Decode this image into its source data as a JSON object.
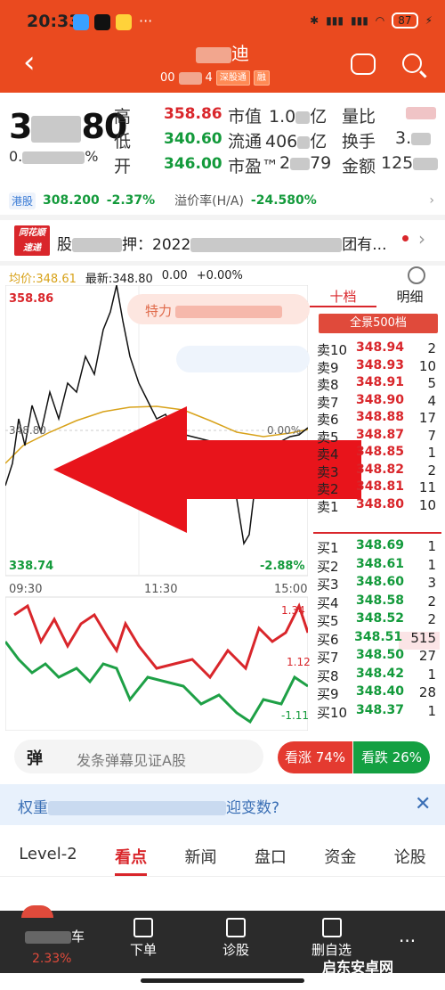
{
  "status": {
    "time": "20:33",
    "battery": "87",
    "dots": "···"
  },
  "header": {
    "back": "‹",
    "title_suffix": "迪",
    "code_prefix": "00",
    "code_suffix": "4",
    "tag1": "深股通",
    "tag2": "融"
  },
  "quote": {
    "price_a": "3",
    "price_b": "80",
    "change_prefix": "0.",
    "change_suffix": "%",
    "high_label": "高",
    "high": "358.86",
    "low_label": "低",
    "low": "340.60",
    "open_label": "开",
    "open": "346.00",
    "mktcap_label": "市值",
    "mktcap_a": "1.0",
    "mktcap_b": "亿",
    "float_label": "流通",
    "float_a": "406",
    "float_b": "亿",
    "pe_label": "市盈™",
    "pe_a": "2",
    "pe_b": "79",
    "vr_label": "量比",
    "turnover_label": "换手",
    "turnover_a": "3.",
    "amount_label": "金额",
    "amount_a": "125"
  },
  "hk": {
    "tag": "港股",
    "price": "308.200",
    "change": "-2.37%",
    "premium_label": "溢价率(H/A)",
    "premium": "-24.580%"
  },
  "news": {
    "logo_top": "同花顺",
    "logo_bottom": "速递",
    "text_a": "股",
    "text_b": "押：2022",
    "text_c": "团有..."
  },
  "chart_head": {
    "avg": "均价:348.61",
    "latest": "最新:348.80",
    "chg": "0.00",
    "pct": "+0.00%"
  },
  "chart": {
    "high": "358.86",
    "mid": "348.80",
    "low": "338.74",
    "pct_mid": "0.00%",
    "pct_low": "-2.88%",
    "times": [
      "09:30",
      "11:30",
      "15:00"
    ],
    "vol_hi": "1.34",
    "vol_mid": "1.12",
    "vol_lo": "-1.11",
    "pill_text": "特力"
  },
  "orderbook": {
    "tab1": "十档",
    "tab2": "明细",
    "full": "全景500档",
    "asks": [
      {
        "l": "卖10",
        "p": "348.94",
        "v": "2"
      },
      {
        "l": "卖9",
        "p": "348.93",
        "v": "10"
      },
      {
        "l": "卖8",
        "p": "348.91",
        "v": "5"
      },
      {
        "l": "卖7",
        "p": "348.90",
        "v": "4"
      },
      {
        "l": "卖6",
        "p": "348.88",
        "v": "17"
      },
      {
        "l": "卖5",
        "p": "348.87",
        "v": "7"
      },
      {
        "l": "卖4",
        "p": "348.85",
        "v": "1"
      },
      {
        "l": "卖3",
        "p": "348.82",
        "v": "2"
      },
      {
        "l": "卖2",
        "p": "348.81",
        "v": "11"
      },
      {
        "l": "卖1",
        "p": "348.80",
        "v": "10"
      }
    ],
    "bids": [
      {
        "l": "买1",
        "p": "348.69",
        "v": "1"
      },
      {
        "l": "买2",
        "p": "348.61",
        "v": "1"
      },
      {
        "l": "买3",
        "p": "348.60",
        "v": "3"
      },
      {
        "l": "买4",
        "p": "348.58",
        "v": "2"
      },
      {
        "l": "买5",
        "p": "348.52",
        "v": "2"
      },
      {
        "l": "买6",
        "p": "348.51",
        "v": "515"
      },
      {
        "l": "买7",
        "p": "348.50",
        "v": "27"
      },
      {
        "l": "买8",
        "p": "348.42",
        "v": "1"
      },
      {
        "l": "买9",
        "p": "348.40",
        "v": "28"
      },
      {
        "l": "买10",
        "p": "348.37",
        "v": "1"
      }
    ]
  },
  "sentiment": {
    "danmu_icon": "弹",
    "danmu_placeholder": "发条弹幕见证A股",
    "up": "看涨 74%",
    "down": "看跌 26%"
  },
  "weight": {
    "prefix": "权重",
    "suffix": "迎变数?",
    "close": "✕"
  },
  "tabs": [
    "Level-2",
    "看点",
    "新闻",
    "盘口",
    "资金",
    "论股"
  ],
  "bottom": {
    "stock_suffix": "车",
    "stock_pct": "2.33%",
    "order": "下单",
    "diagnose": "诊股",
    "watch": "删自选",
    "more": "···"
  },
  "watermark": "启东安卓网"
}
